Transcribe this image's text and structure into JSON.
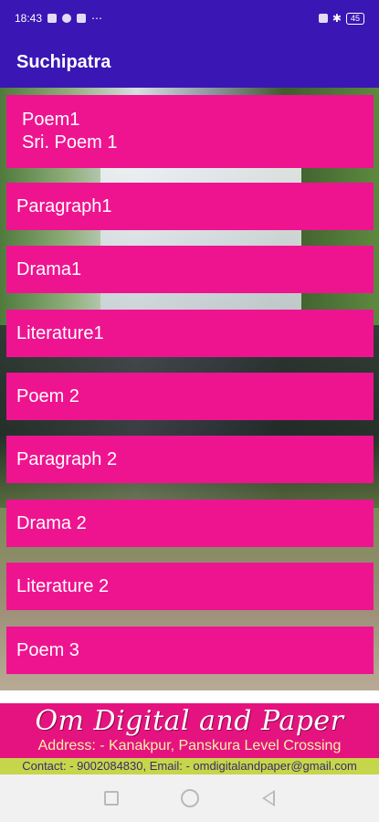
{
  "status_bar": {
    "time": "18:43",
    "left_icons": [
      "signal-icon",
      "whatsapp-icon",
      "apps-icon",
      "more-icon"
    ],
    "right_icons": [
      "volte-icon",
      "bluetooth-icon",
      "battery-icon"
    ],
    "battery": "45"
  },
  "app_bar": {
    "title": "Suchipatra",
    "color": "#3a16b4"
  },
  "menu": {
    "button_color": "#ee1490",
    "items": [
      {
        "line1": "Poem1",
        "line2": "Sri. Poem 1"
      },
      {
        "label": "Paragraph1"
      },
      {
        "label": "Drama1"
      },
      {
        "label": "Literature1"
      },
      {
        "label": "Poem 2"
      },
      {
        "label": "Paragraph 2"
      },
      {
        "label": "Drama 2"
      },
      {
        "label": "Literature 2"
      },
      {
        "label": "Poem 3"
      }
    ]
  },
  "banner": {
    "title": "Om Digital and Paper",
    "address": "Address: - Kanakpur, Panskura Level Crossing",
    "contact": "Contact: - 9002084830, Email: - omdigitalandpaper@gmail.com"
  },
  "nav_bar": {
    "buttons": [
      "recent-apps-button",
      "home-button",
      "back-button"
    ]
  }
}
